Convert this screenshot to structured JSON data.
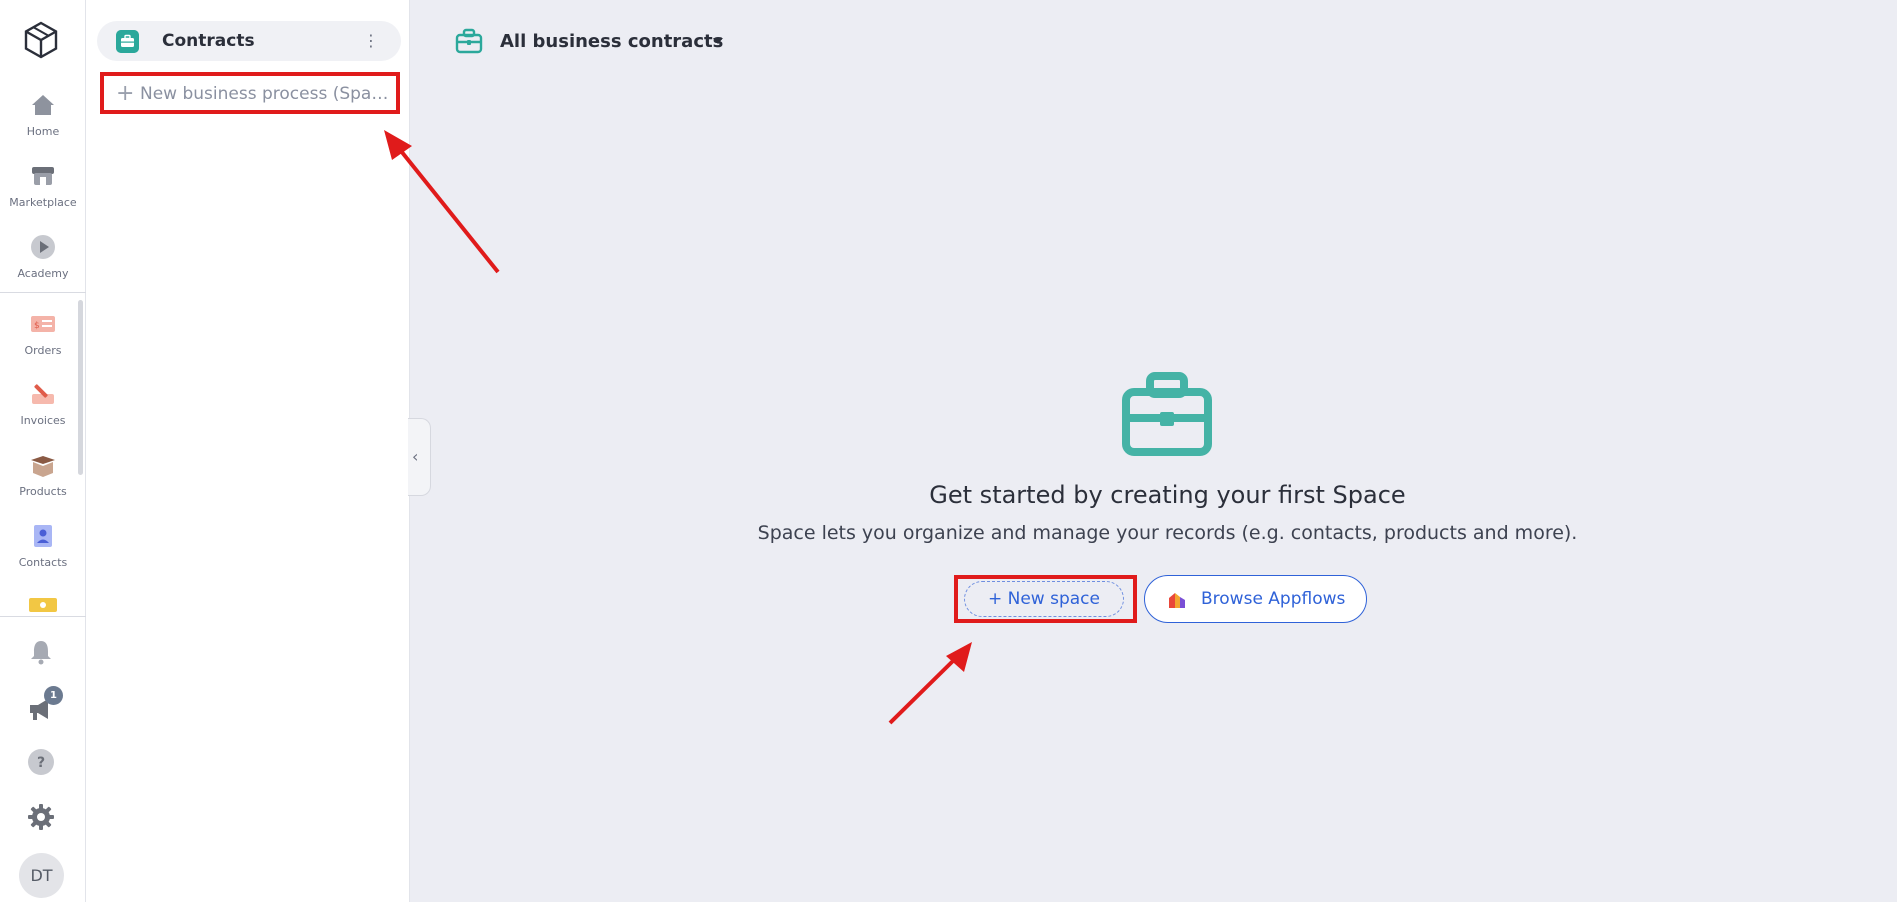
{
  "rail": {
    "items": [
      {
        "label": "Home",
        "icon": "home-icon"
      },
      {
        "label": "Marketplace",
        "icon": "store-icon"
      },
      {
        "label": "Academy",
        "icon": "play-icon"
      },
      {
        "label": "Orders",
        "icon": "orders-icon"
      },
      {
        "label": "Invoices",
        "icon": "invoice-icon"
      },
      {
        "label": "Products",
        "icon": "box-icon"
      },
      {
        "label": "Contacts",
        "icon": "contacts-icon"
      }
    ],
    "notification_badge": "1",
    "avatar_initials": "DT"
  },
  "sidebar": {
    "app_title": "Contracts",
    "new_process_label": "New business process (Space)"
  },
  "main": {
    "view_title": "All business contracts",
    "empty_title": "Get started by creating your first Space",
    "empty_description": "Space lets you organize and manage your records (e.g. contacts, products and more).",
    "new_space_label": "+ New space",
    "browse_label": "Browse Appflows"
  },
  "colors": {
    "accent_teal": "#2ba89b",
    "primary_blue": "#2f62d8",
    "annotation_red": "#e01b1b"
  }
}
